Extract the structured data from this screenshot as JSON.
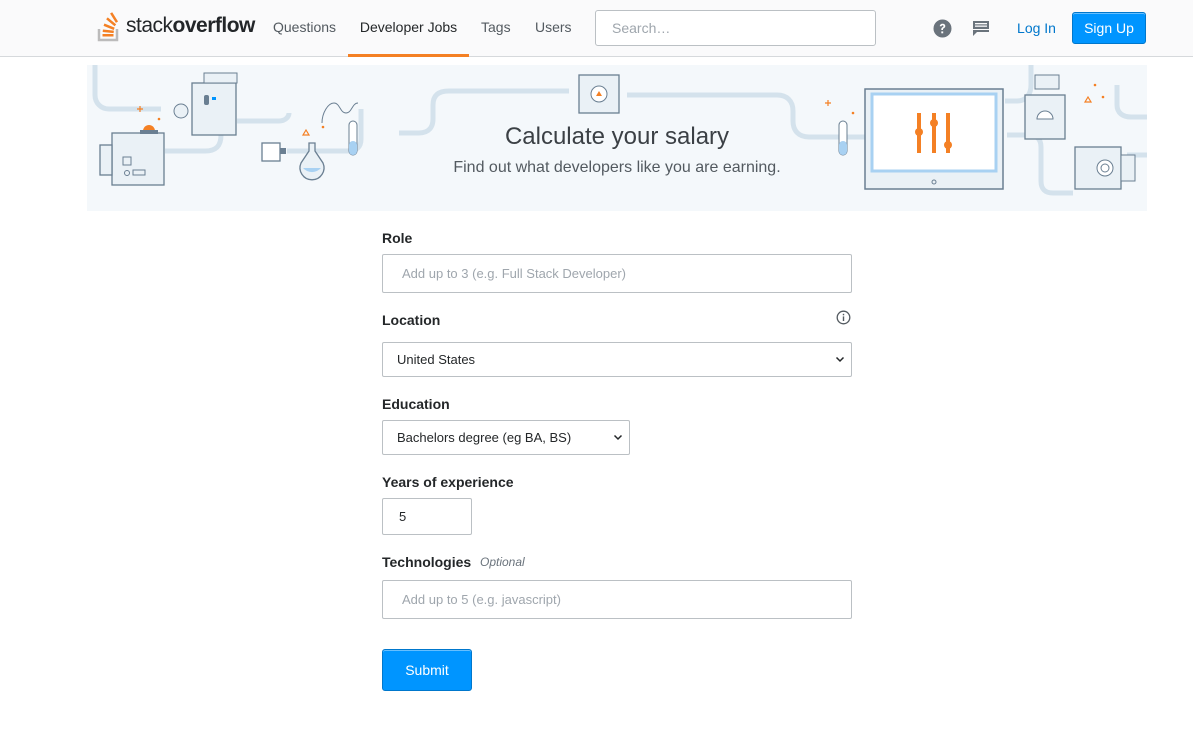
{
  "header": {
    "logo_light": "stack",
    "logo_bold": "overflow",
    "nav": [
      "Questions",
      "Developer Jobs",
      "Tags",
      "Users"
    ],
    "active_nav": "Developer Jobs",
    "search_placeholder": "Search…",
    "login_label": "Log In",
    "signup_label": "Sign Up",
    "icons": [
      "help-icon",
      "inbox-icon"
    ]
  },
  "banner": {
    "title": "Calculate your salary",
    "subtitle": "Find out what developers like you are earning."
  },
  "form": {
    "role": {
      "label": "Role",
      "placeholder": "Add up to 3 (e.g. Full Stack Developer)"
    },
    "location": {
      "label": "Location",
      "value": "United States",
      "icon": "info-icon"
    },
    "education": {
      "label": "Education",
      "value": "Bachelors degree (eg BA, BS)"
    },
    "experience": {
      "label": "Years of experience",
      "value": "5"
    },
    "technologies": {
      "label": "Technologies",
      "optional_label": "Optional",
      "placeholder": "Add up to 5 (e.g. javascript)"
    },
    "submit_label": "Submit"
  },
  "colors": {
    "accent": "#f48024",
    "primary_button": "#0095ff",
    "link": "#0077cc",
    "banner_bg": "#f4f8fb"
  }
}
